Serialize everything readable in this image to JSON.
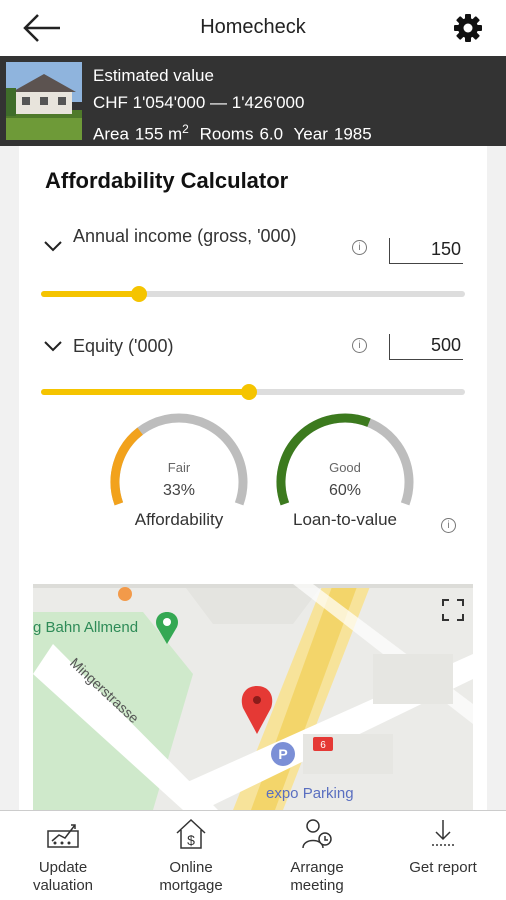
{
  "header": {
    "title": "Homecheck",
    "back_icon": "arrow-left-icon",
    "settings_icon": "gear-icon"
  },
  "property": {
    "estimated_label": "Estimated value",
    "range": "CHF 1'054'000 — 1'426'000",
    "area_label": "Area",
    "area_value": "155 m",
    "area_unit_sup": "2",
    "rooms_label": "Rooms",
    "rooms_value": "6.0",
    "year_label": "Year",
    "year_value": "1985"
  },
  "calculator": {
    "title": "Affordability Calculator",
    "income": {
      "label": "Annual income (gross, '000)",
      "value": "150",
      "slider_fraction": 0.23
    },
    "equity": {
      "label": "Equity ('000)",
      "value": "500",
      "slider_fraction": 0.49
    },
    "gauges": [
      {
        "status": "Fair",
        "percent": "33%",
        "label": "Affordability",
        "fraction": 0.33,
        "color": "#f2a21c"
      },
      {
        "status": "Good",
        "percent": "60%",
        "label": "Loan-to-value",
        "fraction": 0.6,
        "color": "#3c7a1e"
      }
    ],
    "track_color": "#f5c400"
  },
  "map": {
    "place_label": "g Bahn Allmend",
    "street_label": "Mingerstrasse",
    "parking_label": "expo Parking",
    "parking_badge": "P",
    "road_number": "6"
  },
  "bottom_nav": [
    {
      "label": "Update valuation",
      "icon": "chart-update-icon"
    },
    {
      "label": "Online mortgage",
      "icon": "house-dollar-icon"
    },
    {
      "label": "Arrange meeting",
      "icon": "person-meeting-icon"
    },
    {
      "label": "Get report",
      "icon": "download-report-icon"
    }
  ]
}
